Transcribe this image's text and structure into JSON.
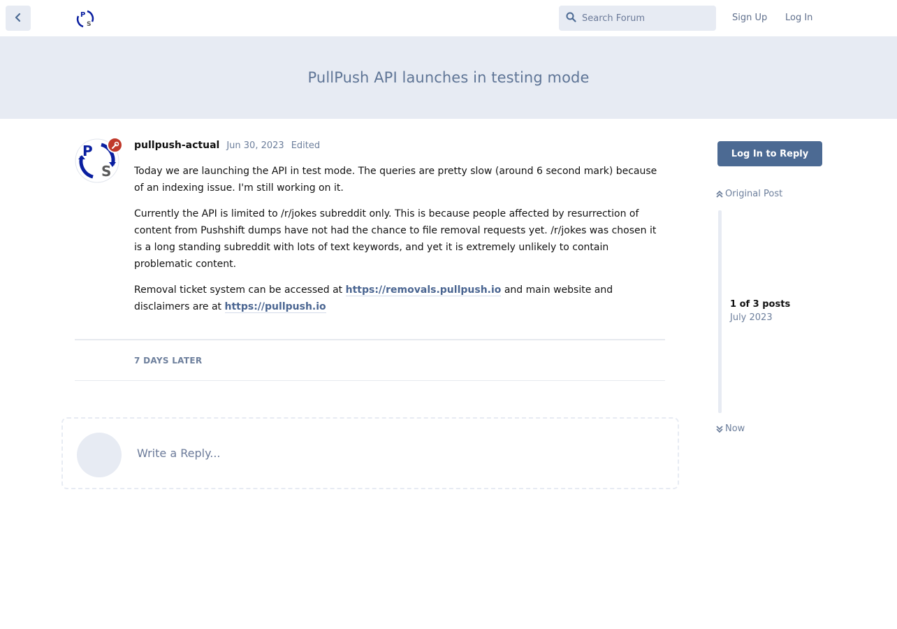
{
  "header": {
    "search_placeholder": "Search Forum",
    "signup_label": "Sign Up",
    "login_label": "Log In"
  },
  "discussion": {
    "title": "PullPush API launches in testing mode"
  },
  "post": {
    "username": "pullpush-actual",
    "date": "Jun 30, 2023",
    "edited_label": "Edited",
    "p1": "Today we are launching the API in test mode. The queries are pretty slow (around 6 second mark) because of an indexing issue. I'm still working on it.",
    "p2": "Currently the API is limited to /r/jokes subreddit only. This is because people affected by resurrection of content from Pushshift dumps have not had the chance to file removal requests yet. /r/jokes was chosen it is a long standing subreddit with lots of text keywords, and yet it is extremely unlikely to contain problematic content.",
    "p3_before": "Removal ticket system can be accessed at ",
    "p3_link1": "https://removals.pullpush.io",
    "p3_middle": " and main website and disclaimers are at ",
    "p3_link2": "https://pullpush.io"
  },
  "time_gap_label": "7 DAYS LATER",
  "reply_placeholder": "Write a Reply...",
  "sidebar": {
    "reply_button": "Log In to Reply",
    "original_post": "Original Post",
    "position": "1 of 3 posts",
    "position_date": "July 2023",
    "now": "Now"
  },
  "colors": {
    "accent": "#4c6a93",
    "hero_bg": "#e7ebf3",
    "badge": "#c0392b"
  }
}
